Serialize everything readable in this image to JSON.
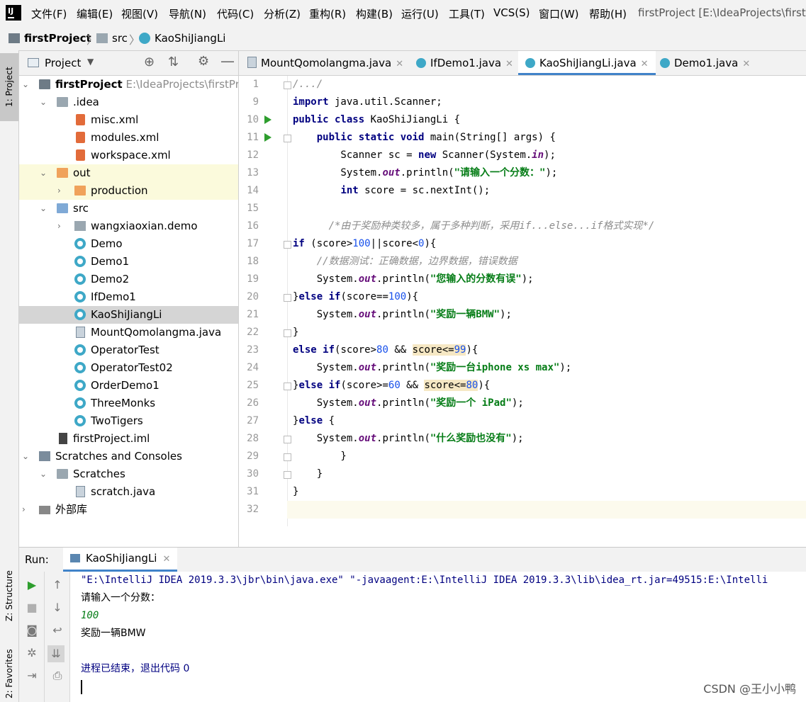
{
  "menubar": {
    "items": [
      "文件(F)",
      "编辑(E)",
      "视图(V)",
      "导航(N)",
      "代码(C)",
      "分析(Z)",
      "重构(R)",
      "构建(B)",
      "运行(U)",
      "工具(T)",
      "VCS(S)",
      "窗口(W)",
      "帮助(H)"
    ],
    "window_title": "firstProject [E:\\IdeaProjects\\firstP"
  },
  "navbar": {
    "project": "firstProject",
    "folder": "src",
    "file": "KaoShiJiangLi"
  },
  "left_stripe": {
    "project_tab": "1: Project",
    "structure_tab": "Z: Structure",
    "favorites_tab": "2: Favorites"
  },
  "project_panel": {
    "title": "Project",
    "root_name": "firstProject",
    "root_path": "E:\\IdeaProjects\\firstProj",
    "items": {
      "idea": ".idea",
      "misc": "misc.xml",
      "modules": "modules.xml",
      "workspace": "workspace.xml",
      "out": "out",
      "production": "production",
      "src": "src",
      "pkg": "wangxiaoxian.demo",
      "demo": "Demo",
      "demo1": "Demo1",
      "demo2": "Demo2",
      "ifdemo1": "IfDemo1",
      "kaoshi": "KaoShiJiangLi",
      "mount": "MountQomolangma.java",
      "optest": "OperatorTest",
      "optest02": "OperatorTest02",
      "order": "OrderDemo1",
      "three": "ThreeMonks",
      "two": "TwoTigers",
      "iml": "firstProject.iml",
      "scratches_consoles": "Scratches and Consoles",
      "scratches": "Scratches",
      "scratch": "scratch.java",
      "extlib": "外部库"
    }
  },
  "tabs": [
    "MountQomolangma.java",
    "IfDemo1.java",
    "KaoShiJiangLi.java",
    "Demo1.java"
  ],
  "editor": {
    "line_numbers": [
      "1",
      "9",
      "10",
      "11",
      "12",
      "13",
      "14",
      "15",
      "16",
      "17",
      "18",
      "19",
      "20",
      "21",
      "22",
      "23",
      "24",
      "25",
      "26",
      "27",
      "28",
      "29",
      "30",
      "31",
      "32"
    ],
    "s_prompt": "\"请输入一个分数：\"",
    "s_err": "\"您输入的分数有误\"",
    "s_bmw": "\"奖励一辆BMW\"",
    "s_iphone": "\"奖励一台iphone xs max\"",
    "s_ipad": "\"奖励一个 iPad\"",
    "s_none": "\"什么奖励也没有\"",
    "comment_block": "/*由于奖励种类较多，属于多种判断，采用if...else...if格式实现*/",
    "comment_line": "//数据测试：正确数据，边界数据，错误数据"
  },
  "run": {
    "label": "Run:",
    "tab": "KaoShiJiangLi",
    "console": {
      "cmd": "\"E:\\IntelliJ IDEA 2019.3.3\\jbr\\bin\\java.exe\" \"-javaagent:E:\\IntelliJ IDEA 2019.3.3\\lib\\idea_rt.jar=49515:E:\\Intelli",
      "prompt": "请输入一个分数：",
      "input": "100",
      "output": "奖励一辆BMW",
      "exit": "进程已结束，退出代码 0"
    }
  },
  "watermark": "CSDN @王小小鸭"
}
